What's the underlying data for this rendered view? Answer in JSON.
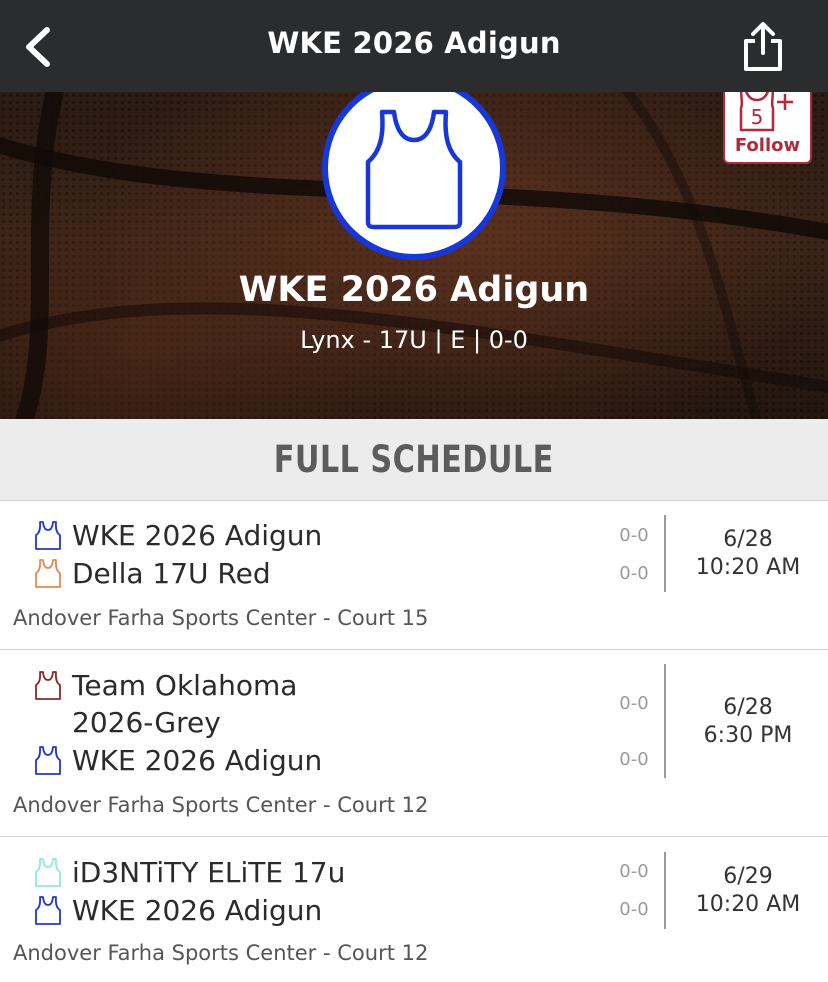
{
  "nav": {
    "title": "WKE 2026 Adigun"
  },
  "hero": {
    "team_name": "WKE 2026 Adigun",
    "subtitle": "Lynx - 17U | E | 0-0",
    "logo_color": "#1737d8",
    "follow": {
      "label": "Follow",
      "badge_number": "5"
    }
  },
  "schedule": {
    "title": "FULL SCHEDULE",
    "games": [
      {
        "teams": [
          {
            "name": "WKE 2026 Adigun",
            "score": "0-0",
            "jersey_color": "#2437c8"
          },
          {
            "name": "Della 17U Red",
            "score": "0-0",
            "jersey_color": "#e08a57"
          }
        ],
        "date": "6/28",
        "time": "10:20 AM",
        "venue": "Andover Farha Sports Center - Court 15"
      },
      {
        "teams": [
          {
            "name": "Team Oklahoma 2026-Grey",
            "score": "0-0",
            "jersey_color": "#8a2a2a"
          },
          {
            "name": "WKE 2026 Adigun",
            "score": "0-0",
            "jersey_color": "#2437c8"
          }
        ],
        "date": "6/28",
        "time": "6:30 PM",
        "venue": "Andover Farha Sports Center - Court 12"
      },
      {
        "teams": [
          {
            "name": "iD3NTiTY ELiTE 17u",
            "score": "0-0",
            "jersey_color": "#8fe6ea"
          },
          {
            "name": "WKE 2026 Adigun",
            "score": "0-0",
            "jersey_color": "#2437c8"
          }
        ],
        "date": "6/29",
        "time": "10:20 AM",
        "venue": "Andover Farha Sports Center - Court 12"
      }
    ]
  },
  "icons": {
    "back": "back-arrow-icon",
    "share": "share-icon",
    "jersey": "jersey-icon"
  }
}
